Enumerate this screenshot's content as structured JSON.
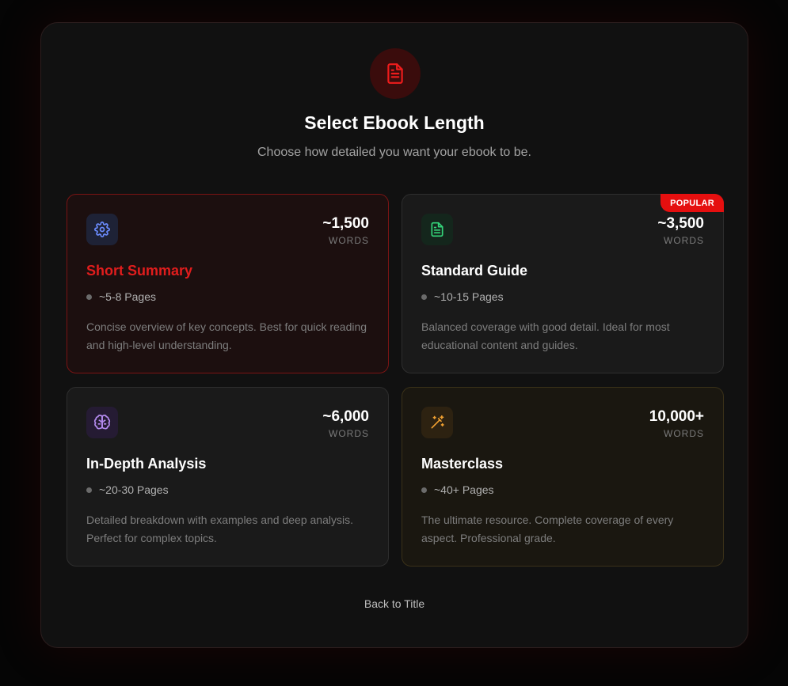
{
  "header": {
    "icon": "document-icon",
    "title": "Select Ebook Length",
    "subtitle": "Choose how detailed you want your ebook to be."
  },
  "options": [
    {
      "icon": "gear-icon",
      "icon_color": "#6b8cff",
      "words": "~1,500",
      "words_unit": "WORDS",
      "title": "Short Summary",
      "pages": "~5-8 Pages",
      "description": "Concise overview of key concepts. Best for quick reading and high-level understanding.",
      "selected": true
    },
    {
      "icon": "document-icon",
      "icon_color": "#34d57a",
      "badge": "POPULAR",
      "words": "~3,500",
      "words_unit": "WORDS",
      "title": "Standard Guide",
      "pages": "~10-15 Pages",
      "description": "Balanced coverage with good detail. Ideal for most educational content and guides."
    },
    {
      "icon": "brain-icon",
      "icon_color": "#b58cf0",
      "words": "~6,000",
      "words_unit": "WORDS",
      "title": "In-Depth Analysis",
      "pages": "~20-30 Pages",
      "description": "Detailed breakdown with examples and deep analysis. Perfect for complex topics."
    },
    {
      "icon": "magic-wand-icon",
      "icon_color": "#f0a030",
      "words": "10,000+",
      "words_unit": "WORDS",
      "title": "Masterclass",
      "pages": "~40+ Pages",
      "description": "The ultimate resource. Complete coverage of every aspect. Professional grade."
    }
  ],
  "footer": {
    "back_label": "Back to Title"
  },
  "colors": {
    "accent": "#e50f0f",
    "background": "#111111"
  }
}
